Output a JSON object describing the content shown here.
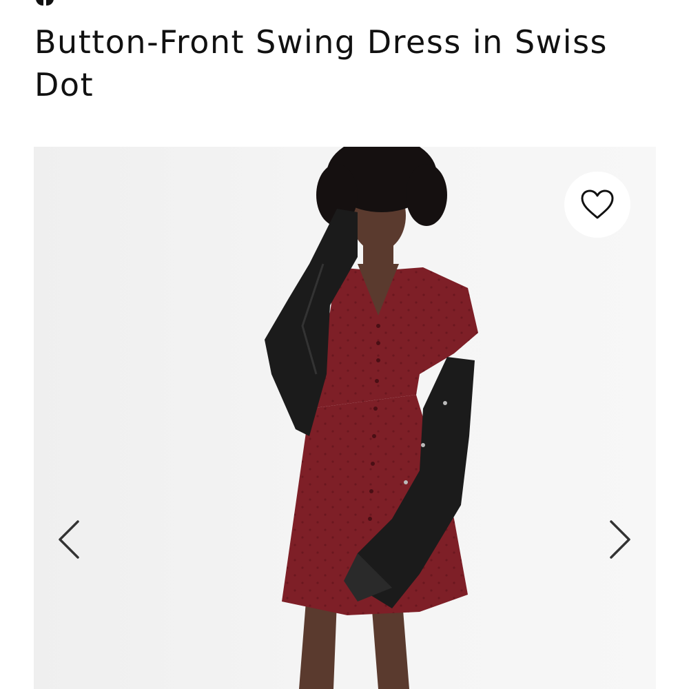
{
  "product": {
    "title": "Button-Front Swing Dress in Swiss Dot"
  },
  "gallery": {
    "favorite_icon": "heart-outline-icon",
    "prev_icon": "chevron-left-icon",
    "next_icon": "chevron-right-icon"
  },
  "colors": {
    "dress": "#7e1f27",
    "jacket": "#1b1b1b",
    "background": "#f2f2f2",
    "text": "#111111"
  }
}
